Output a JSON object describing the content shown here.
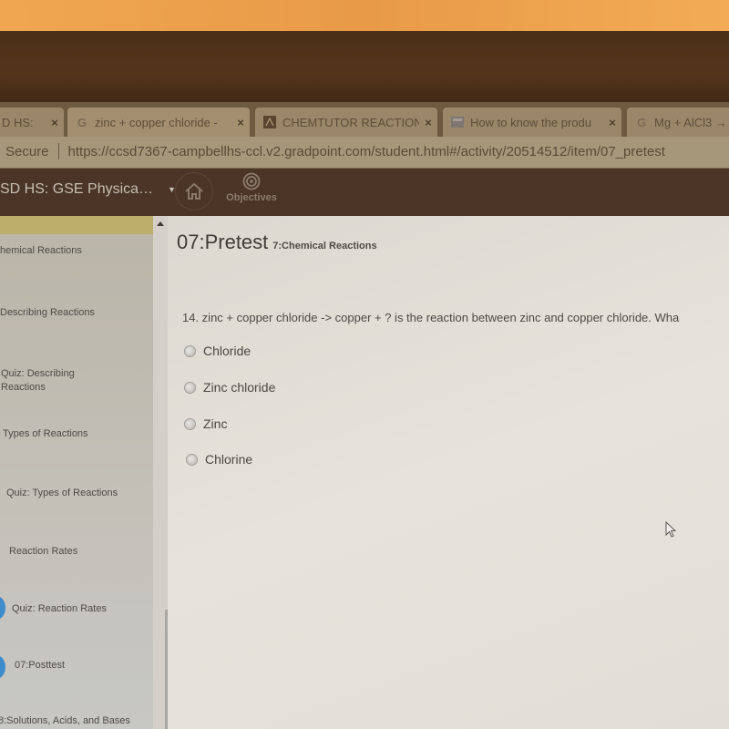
{
  "browser": {
    "tabs": [
      {
        "title": "D HS:",
        "favicon": "site-icon",
        "active": false
      },
      {
        "title": "zinc + copper chloride -",
        "favicon": "google-icon",
        "active": true
      },
      {
        "title": "CHEMTUTOR REACTION",
        "favicon": "chemtutor-icon",
        "active": false
      },
      {
        "title": "How to know the produ",
        "favicon": "page-icon",
        "active": false
      },
      {
        "title": "Mg + AlCl3 →",
        "favicon": "google-icon",
        "active": false
      }
    ],
    "close_glyph": "×",
    "secure_label": "Secure",
    "url": "https://ccsd7367-campbellhs-ccl.v2.gradpoint.com/student.html#/activity/20514512/item/07_pretest"
  },
  "navbar": {
    "course_label": "SD HS: GSE Physica…",
    "caret": "▼",
    "home_icon": "home-icon",
    "objectives_label": "Objectives"
  },
  "sidebar": {
    "items": [
      {
        "label": "hemical Reactions"
      },
      {
        "label": "Describing Reactions"
      },
      {
        "label": "Quiz: Describing Reactions"
      },
      {
        "label": "Types of Reactions"
      },
      {
        "label": "Quiz: Types of Reactions"
      },
      {
        "label": "Reaction Rates"
      },
      {
        "label": "Quiz: Reaction Rates"
      },
      {
        "label": "07:Posttest"
      },
      {
        "label": "8:Solutions, Acids, and Bases"
      }
    ]
  },
  "main": {
    "title": "07:Pretest",
    "subtitle": "7:Chemical Reactions",
    "question": "14. zinc + copper chloride -> copper + ?   is the reaction between zinc and copper chloride. Wha",
    "options": [
      {
        "label": "Chloride",
        "selected": false
      },
      {
        "label": "Zinc chloride",
        "selected": false
      },
      {
        "label": "Zinc",
        "selected": false
      },
      {
        "label": "Chlorine",
        "selected": false
      }
    ]
  },
  "colors": {
    "navbar_bg": "#4a3526",
    "progress_dot": "#3f8ccc"
  }
}
